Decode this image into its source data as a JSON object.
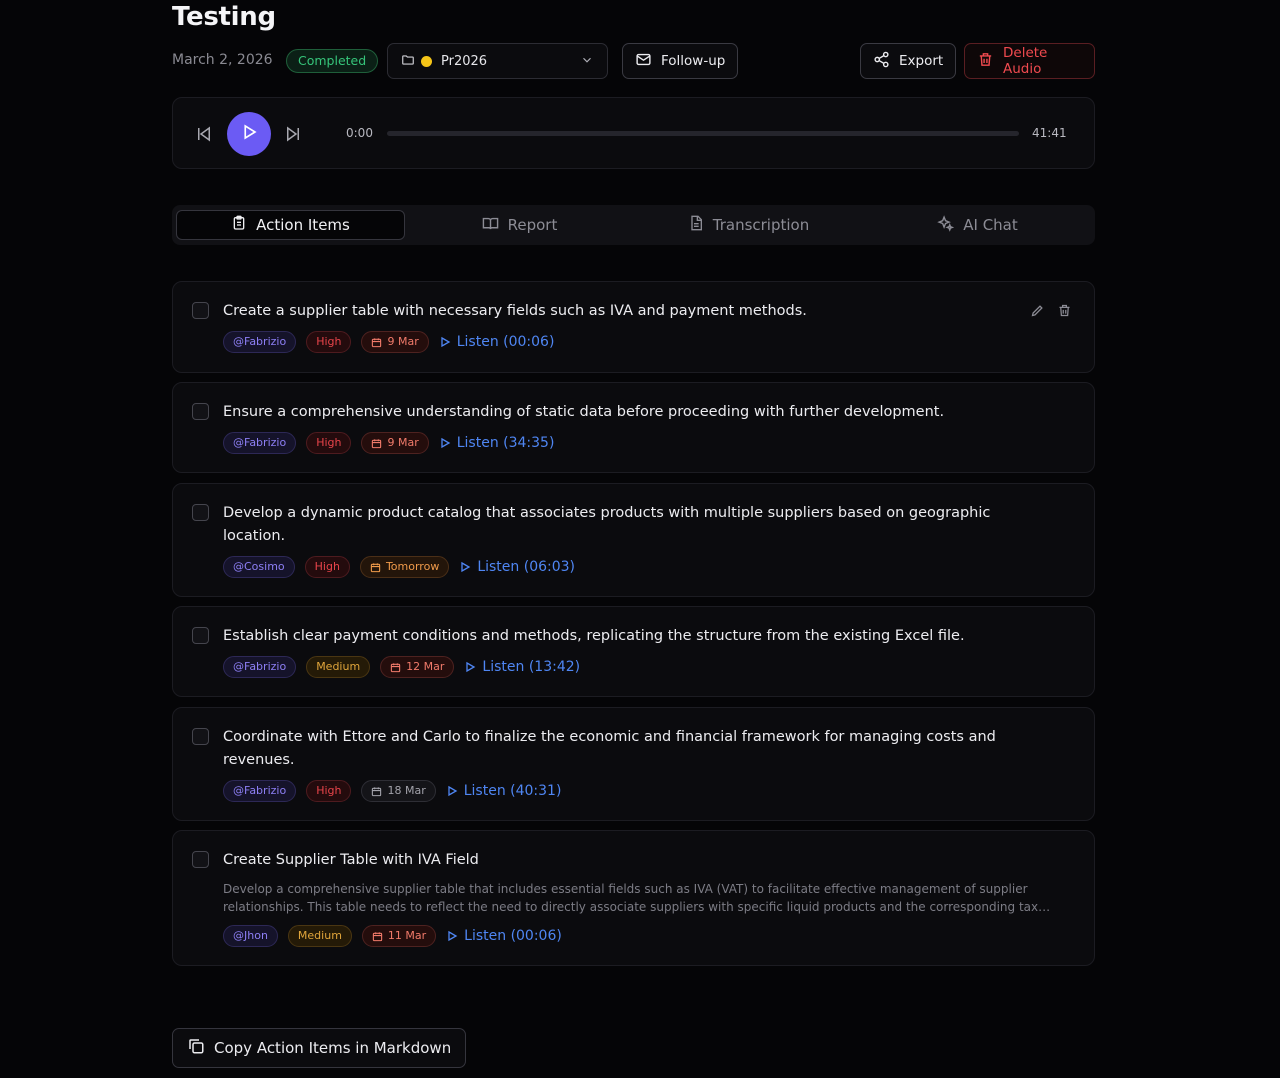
{
  "header": {
    "title": "Testing",
    "date": "March 2, 2026",
    "status": "Completed",
    "folder": "Pr2026",
    "folder_color": "#f5c518",
    "followup_label": "Follow-up",
    "export_label": "Export",
    "delete_label": "Delete Audio"
  },
  "player": {
    "current_time": "0:00",
    "duration": "41:41",
    "progress_percent": 0,
    "accent": "#6b5bf4"
  },
  "tabs": [
    {
      "label": "Action Items",
      "icon": "clipboard-icon",
      "active": true
    },
    {
      "label": "Report",
      "icon": "book-icon",
      "active": false
    },
    {
      "label": "Transcription",
      "icon": "document-icon",
      "active": false
    },
    {
      "label": "AI Chat",
      "icon": "sparkles-icon",
      "active": false
    }
  ],
  "action_items": [
    {
      "text": "Create a supplier table with necessary fields such as IVA and payment methods.",
      "assignee": "@Fabrizio",
      "priority": "High",
      "due": "9 Mar",
      "listen": "Listen (00:06)"
    },
    {
      "text": "Ensure a comprehensive understanding of static data before proceeding with further development.",
      "assignee": "@Fabrizio",
      "priority": "High",
      "due": "9 Mar",
      "listen": "Listen (34:35)"
    },
    {
      "text": "Develop a dynamic product catalog that associates products with multiple suppliers based on geographic location.",
      "assignee": "@Cosimo",
      "priority": "High",
      "due": "Tomorrow",
      "listen": "Listen (06:03)"
    },
    {
      "text": "Establish clear payment conditions and methods, replicating the structure from the existing Excel file.",
      "assignee": "@Fabrizio",
      "priority": "Medium",
      "due": "12 Mar",
      "listen": "Listen (13:42)"
    },
    {
      "text": "Coordinate with Ettore and Carlo to finalize the economic and financial framework for managing costs and revenues.",
      "assignee": "@Fabrizio",
      "priority": "High",
      "due": "18 Mar",
      "listen": "Listen (40:31)"
    },
    {
      "text": "Create Supplier Table with IVA Field",
      "description": "Develop a comprehensive supplier table that includes essential fields such as IVA (VAT) to facilitate effective management of supplier relationships. This table needs to reflect the need to directly associate suppliers with specific liquid products and the corresponding tax…",
      "assignee": "@Jhon",
      "priority": "Medium",
      "due": "11 Mar",
      "listen": "Listen (00:06)"
    }
  ],
  "footer": {
    "copy_label": "Copy Action Items in Markdown"
  }
}
